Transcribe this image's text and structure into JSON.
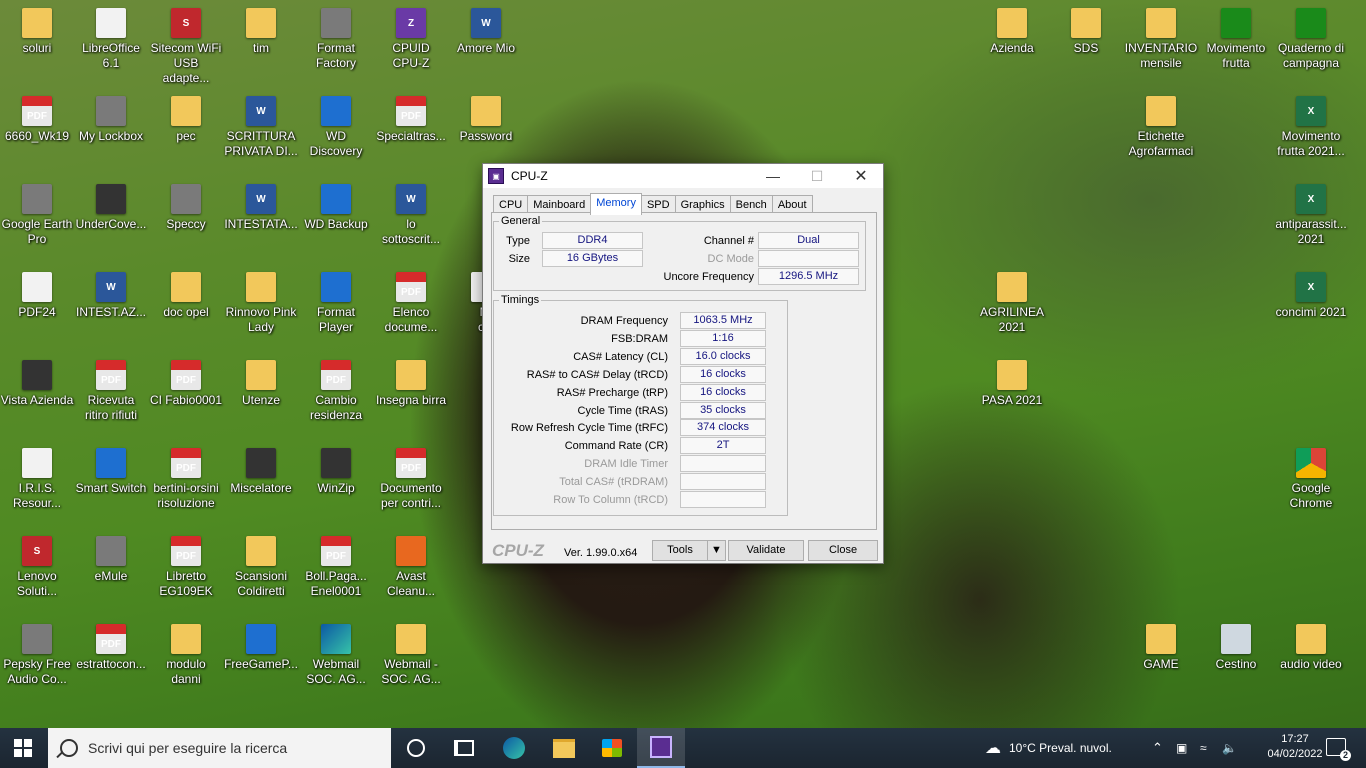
{
  "desktop": {
    "icons": [
      {
        "label1": "soluri",
        "label2": "",
        "type": "folder"
      },
      {
        "label1": "LibreOffice",
        "label2": "6.1",
        "type": "file"
      },
      {
        "label1": "Sitecom WiFi",
        "label2": "USB adapte...",
        "type": "red"
      },
      {
        "label1": "tim",
        "label2": "",
        "type": "folder"
      },
      {
        "label1": "Format",
        "label2": "Factory",
        "type": "grey"
      },
      {
        "label1": "CPUID",
        "label2": "CPU-Z",
        "type": "app"
      },
      {
        "label1": "Amore Mio",
        "label2": "",
        "type": "word"
      },
      {
        "label1": "6660_Wk19",
        "label2": "",
        "type": "pdf"
      },
      {
        "label1": "My Lockbox",
        "label2": "",
        "type": "grey"
      },
      {
        "label1": "pec",
        "label2": "",
        "type": "folder"
      },
      {
        "label1": "SCRITTURA",
        "label2": "PRIVATA DI...",
        "type": "word"
      },
      {
        "label1": "WD",
        "label2": "Discovery",
        "type": "blue"
      },
      {
        "label1": "Specialtras...",
        "label2": "",
        "type": "pdf"
      },
      {
        "label1": "Password",
        "label2": "",
        "type": "folder"
      },
      {
        "label1": "Google Earth",
        "label2": "Pro",
        "type": "grey"
      },
      {
        "label1": "UnderCove...",
        "label2": "",
        "type": "dark"
      },
      {
        "label1": "Speccy",
        "label2": "",
        "type": "grey"
      },
      {
        "label1": "INTESTATA...",
        "label2": "",
        "type": "word"
      },
      {
        "label1": "WD Backup",
        "label2": "",
        "type": "blue"
      },
      {
        "label1": "lo",
        "label2": "sottoscrit...",
        "type": "word"
      },
      {
        "label1": "PDF24",
        "label2": "",
        "type": "file"
      },
      {
        "label1": "INTEST.AZ...",
        "label2": "",
        "type": "word"
      },
      {
        "label1": "doc opel",
        "label2": "",
        "type": "folder"
      },
      {
        "label1": "Rinnovo Pink",
        "label2": "Lady",
        "type": "folder"
      },
      {
        "label1": "Format",
        "label2": "Player",
        "type": "blue"
      },
      {
        "label1": "Elenco",
        "label2": "docume...",
        "type": "pdf"
      },
      {
        "label1": "Vista Azienda",
        "label2": "",
        "type": "dark"
      },
      {
        "label1": "Ricevuta",
        "label2": "ritiro rifiuti",
        "type": "pdf"
      },
      {
        "label1": "CI Fabio0001",
        "label2": "",
        "type": "pdf"
      },
      {
        "label1": "Utenze",
        "label2": "",
        "type": "folder"
      },
      {
        "label1": "Cambio",
        "label2": "residenza",
        "type": "pdf"
      },
      {
        "label1": "Insegna birra",
        "label2": "",
        "type": "folder"
      },
      {
        "label1": "I.R.I.S.",
        "label2": "Resour...",
        "type": "file"
      },
      {
        "label1": "Smart Switch",
        "label2": "",
        "type": "blue"
      },
      {
        "label1": "bertini-orsini",
        "label2": "risoluzione",
        "type": "pdf"
      },
      {
        "label1": "Miscelatore",
        "label2": "",
        "type": "dark"
      },
      {
        "label1": "WinZip",
        "label2": "",
        "type": "dark"
      },
      {
        "label1": "Documento",
        "label2": "per contri...",
        "type": "pdf"
      },
      {
        "label1": "Lenovo",
        "label2": "Soluti...",
        "type": "red"
      },
      {
        "label1": "eMule",
        "label2": "",
        "type": "grey"
      },
      {
        "label1": "Libretto",
        "label2": "EG109EK",
        "type": "pdf"
      },
      {
        "label1": "Scansioni",
        "label2": "Coldiretti",
        "type": "folder"
      },
      {
        "label1": "Boll.Paga...",
        "label2": "Enel0001",
        "type": "pdf"
      },
      {
        "label1": "Avast",
        "label2": "Cleanu...",
        "type": "orange"
      },
      {
        "label1": "Pepsky Free",
        "label2": "Audio Co...",
        "type": "grey"
      },
      {
        "label1": "estrattocon...",
        "label2": "",
        "type": "pdf"
      },
      {
        "label1": "modulo",
        "label2": "danni",
        "type": "folder"
      },
      {
        "label1": "FreeGameP...",
        "label2": "",
        "type": "blue"
      },
      {
        "label1": "Webmail",
        "label2": "SOC. AG...",
        "type": "edge"
      },
      {
        "label1": "Webmail -",
        "label2": "SOC. AG...",
        "type": "folder"
      },
      {
        "label1": "Mi",
        "label2": "cat",
        "type": "file"
      },
      {
        "label1": "Azienda",
        "label2": "",
        "type": "folder"
      },
      {
        "label1": "SDS",
        "label2": "",
        "type": "folder"
      },
      {
        "label1": "INVENTARIO",
        "label2": "mensile",
        "type": "folder"
      },
      {
        "label1": "Movimento",
        "label2": "frutta",
        "type": "tree"
      },
      {
        "label1": "Quaderno di",
        "label2": "campagna",
        "type": "tree"
      },
      {
        "label1": "Etichette",
        "label2": "Agrofarmaci",
        "type": "folder"
      },
      {
        "label1": "Movimento",
        "label2": "frutta 2021...",
        "type": "excel"
      },
      {
        "label1": "antiparassit...",
        "label2": "2021",
        "type": "excel"
      },
      {
        "label1": "AGRILINEA",
        "label2": "2021",
        "type": "folder"
      },
      {
        "label1": "concimi 2021",
        "label2": "",
        "type": "excel"
      },
      {
        "label1": "PASA 2021",
        "label2": "",
        "type": "folder"
      },
      {
        "label1": "Google",
        "label2": "Chrome",
        "type": "chrome"
      },
      {
        "label1": "GAME",
        "label2": "",
        "type": "folder"
      },
      {
        "label1": "Cestino",
        "label2": "",
        "type": "trash"
      },
      {
        "label1": "audio video",
        "label2": "",
        "type": "folder"
      }
    ]
  },
  "cpuz": {
    "title": "CPU-Z",
    "tabs": [
      "CPU",
      "Mainboard",
      "Memory",
      "SPD",
      "Graphics",
      "Bench",
      "About"
    ],
    "active_tab": "Memory",
    "general": {
      "legend": "General",
      "type_label": "Type",
      "type_value": "DDR4",
      "size_label": "Size",
      "size_value": "16 GBytes",
      "channel_label": "Channel #",
      "channel_value": "Dual",
      "dcmode_label": "DC Mode",
      "dcmode_value": "",
      "uncore_label": "Uncore Frequency",
      "uncore_value": "1296.5 MHz"
    },
    "timings": {
      "legend": "Timings",
      "rows": [
        {
          "label": "DRAM Frequency",
          "value": "1063.5 MHz",
          "enabled": true
        },
        {
          "label": "FSB:DRAM",
          "value": "1:16",
          "enabled": true
        },
        {
          "label": "CAS# Latency (CL)",
          "value": "16.0 clocks",
          "enabled": true
        },
        {
          "label": "RAS# to CAS# Delay (tRCD)",
          "value": "16 clocks",
          "enabled": true
        },
        {
          "label": "RAS# Precharge (tRP)",
          "value": "16 clocks",
          "enabled": true
        },
        {
          "label": "Cycle Time (tRAS)",
          "value": "35 clocks",
          "enabled": true
        },
        {
          "label": "Row Refresh Cycle Time (tRFC)",
          "value": "374 clocks",
          "enabled": true
        },
        {
          "label": "Command Rate (CR)",
          "value": "2T",
          "enabled": true
        },
        {
          "label": "DRAM Idle Timer",
          "value": "",
          "enabled": false
        },
        {
          "label": "Total CAS# (tRDRAM)",
          "value": "",
          "enabled": false
        },
        {
          "label": "Row To Column (tRCD)",
          "value": "",
          "enabled": false
        }
      ]
    },
    "footer": {
      "brand": "CPU-Z",
      "version": "Ver. 1.99.0.x64",
      "tools": "Tools",
      "validate": "Validate",
      "close": "Close"
    }
  },
  "taskbar": {
    "search_placeholder": "Scrivi qui per eseguire la ricerca",
    "weather": "10°C  Preval. nuvol.",
    "time": "17:27",
    "date": "04/02/2022",
    "notifications": "2"
  },
  "colors": {
    "taskbar": "#1b2530",
    "value_text": "#151580",
    "active_tab": "#0046d5"
  }
}
